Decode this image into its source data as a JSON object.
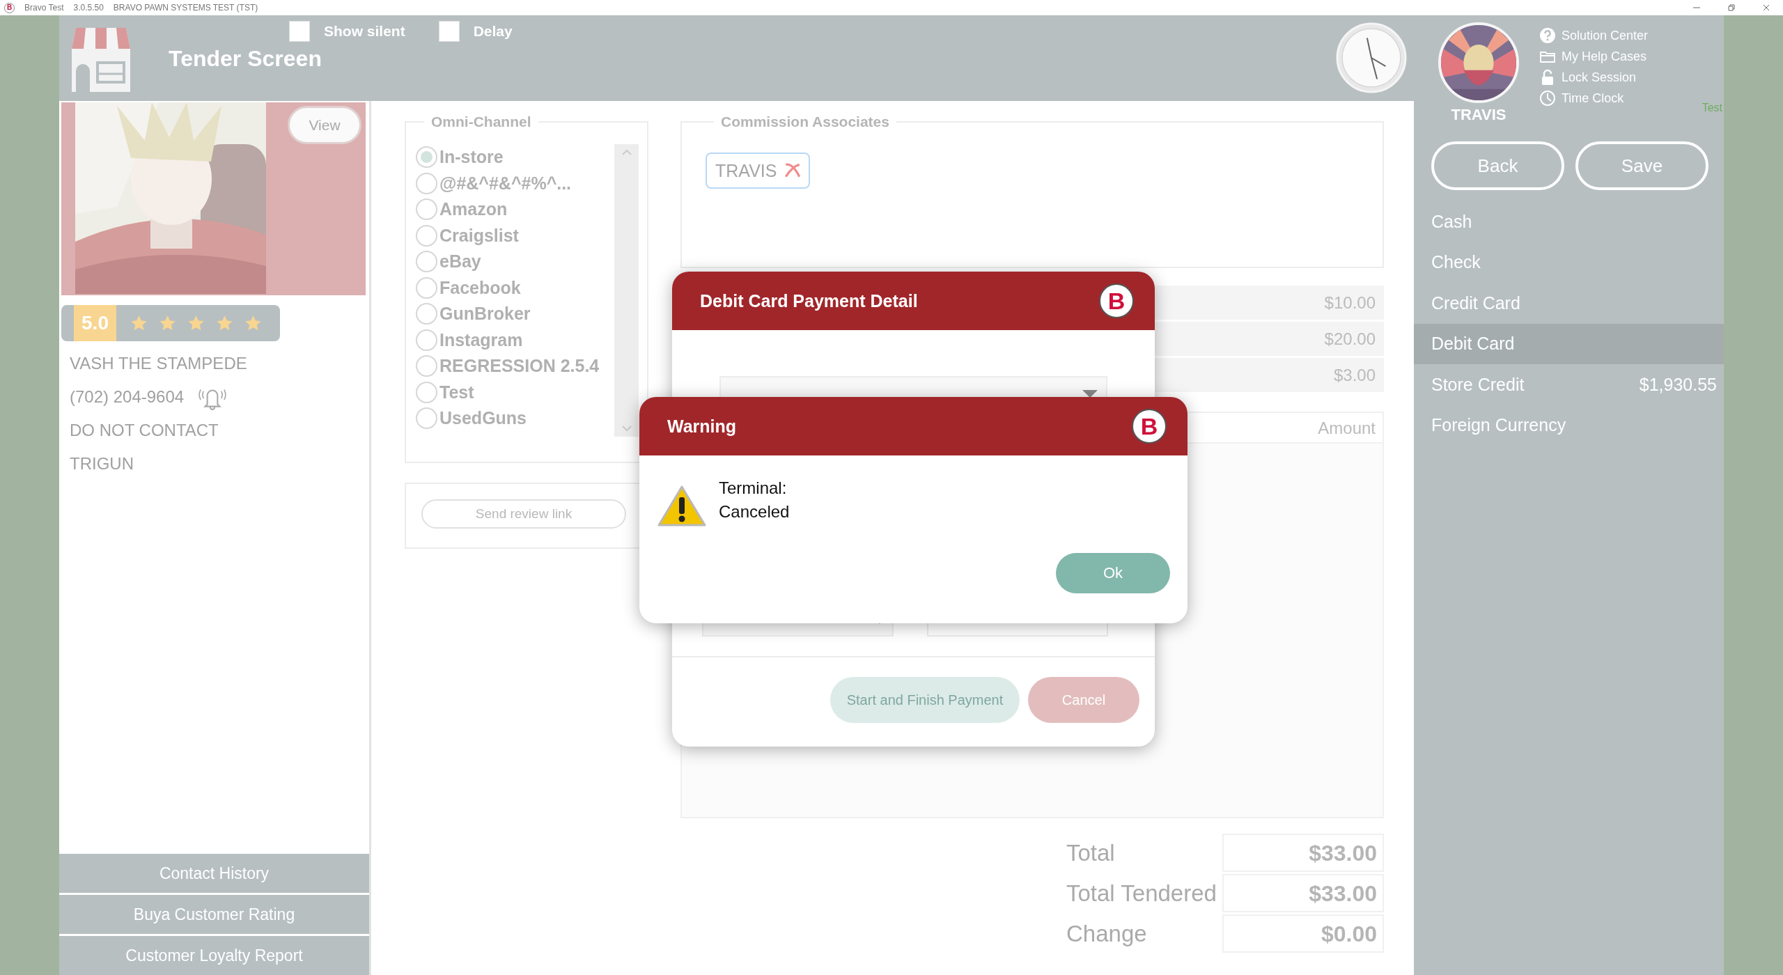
{
  "title_bar": {
    "logo": "B",
    "app": "Bravo Test",
    "version": "3.0.5.50",
    "system": "BRAVO PAWN SYSTEMS TEST (TST)"
  },
  "header": {
    "title": "Tender Screen",
    "options": [
      {
        "label": "Show silent",
        "checked": false
      },
      {
        "label": "Delay",
        "checked": false
      }
    ]
  },
  "user": {
    "photo": {
      "kind": "picture"
    },
    "name": "TRAVIS",
    "links": [
      "Solution Center",
      "My Help Cases",
      "Lock Session",
      "Time Clock"
    ],
    "environment_label": "Test"
  },
  "actions": [
    "Back",
    "Save"
  ],
  "tenders": [
    {
      "label": "Cash",
      "selected": false
    },
    {
      "label": "Check",
      "selected": false
    },
    {
      "label": "Credit Card",
      "selected": false
    },
    {
      "label": "Debit Card",
      "selected": true
    },
    {
      "label": "Store Credit",
      "selected": false,
      "amount": "$1,930.55"
    },
    {
      "label": "Foreign Currency",
      "selected": false
    }
  ],
  "customer": {
    "photo": {
      "kind": "picture"
    },
    "view_button": "View",
    "rating": {
      "score": "5.0",
      "stars": 5
    },
    "name": "VASH THE STAMPEDE",
    "phone": "(702) 204-9604",
    "notes": [
      "DO NOT CONTACT",
      "TRIGUN"
    ],
    "buttons": [
      "Contact History",
      "Buya Customer Rating",
      "Customer Loyalty Report"
    ]
  },
  "omni_channel": {
    "title": "Omni-Channel",
    "options": [
      {
        "label": "In-store",
        "selected": true
      },
      {
        "label": "@#&^#&^#%^...",
        "selected": false
      },
      {
        "label": "Amazon",
        "selected": false
      },
      {
        "label": "Craigslist",
        "selected": false
      },
      {
        "label": "eBay",
        "selected": false
      },
      {
        "label": "Facebook",
        "selected": false
      },
      {
        "label": "GunBroker",
        "selected": false
      },
      {
        "label": "Instagram",
        "selected": false
      },
      {
        "label": "REGRESSION 2.5.4",
        "selected": false
      },
      {
        "label": "Test",
        "selected": false
      },
      {
        "label": "UsedGuns",
        "selected": false
      }
    ],
    "review_button": "Send review link"
  },
  "commission": {
    "title": "Commission Associates",
    "associates": [
      "TRAVIS"
    ]
  },
  "payments": {
    "rows": [
      {
        "amount": "$10.00"
      },
      {
        "amount": "$20.00"
      },
      {
        "amount": "$3.00"
      }
    ],
    "amount_header": "Amount"
  },
  "totals": [
    {
      "label": "Total",
      "value": "$33.00"
    },
    {
      "label": "Total Tendered",
      "value": "$33.00"
    },
    {
      "label": "Change",
      "value": "$0.00"
    }
  ],
  "payment_dialog": {
    "title": "Debit Card Payment Detail",
    "logo": "B",
    "start_button": "Start and Finish Payment",
    "cancel_button": "Cancel"
  },
  "warning_dialog": {
    "title": "Warning",
    "logo": "B",
    "message": "Terminal:\nCanceled",
    "button": "Ok"
  }
}
